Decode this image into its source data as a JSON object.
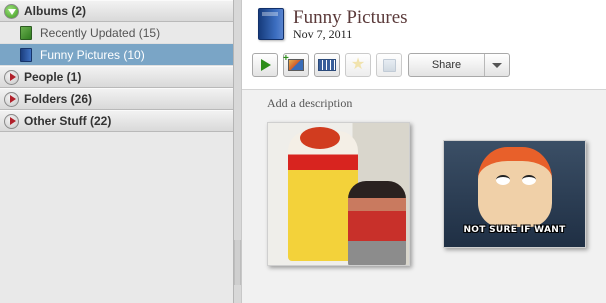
{
  "sidebar": {
    "sections": [
      {
        "label": "Albums (2)",
        "expanded": true,
        "items": [
          {
            "label": "Recently Updated (15)",
            "icon": "recent-album-icon"
          },
          {
            "label": "Funny Pictures (10)",
            "icon": "album-book-icon",
            "selected": true
          }
        ]
      },
      {
        "label": "People (1)",
        "expanded": false
      },
      {
        "label": "Folders (26)",
        "expanded": false
      },
      {
        "label": "Other Stuff (22)",
        "expanded": false
      }
    ]
  },
  "album": {
    "title": "Funny Pictures",
    "date": "Nov 7, 2011",
    "description_placeholder": "Add a description"
  },
  "toolbar": {
    "share_label": "Share"
  },
  "photos": [
    {
      "name": "clown-photo"
    },
    {
      "name": "fry-meme-photo",
      "caption": "NOT SURE IF WANT"
    }
  ],
  "colors": {
    "selection": "#7aa5c6",
    "play_green": "#2d8d1a",
    "title_color": "#5b3a3a"
  }
}
